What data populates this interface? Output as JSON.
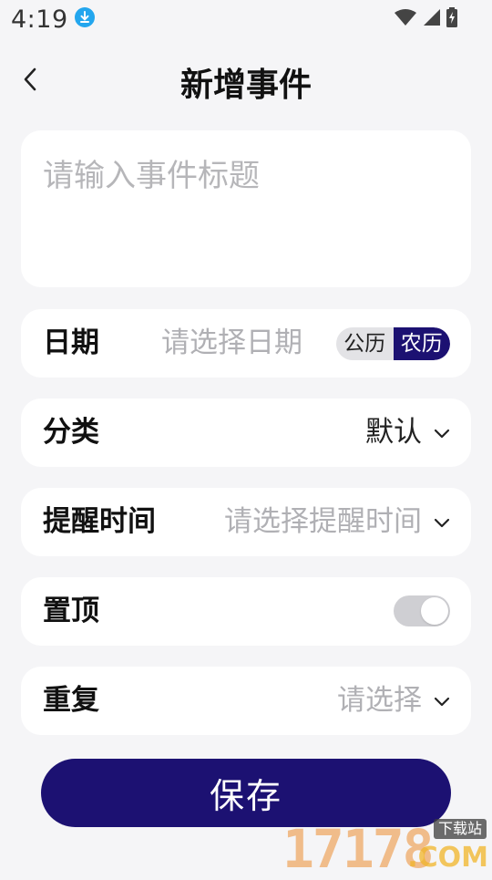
{
  "status_bar": {
    "time": "4:19",
    "icons": [
      "download-badge-icon",
      "wifi-icon",
      "signal-icon",
      "battery-charging-icon"
    ]
  },
  "header": {
    "title": "新增事件",
    "back_icon": "chevron-left-icon"
  },
  "title_input": {
    "placeholder": "请输入事件标题",
    "value": ""
  },
  "rows": {
    "date": {
      "label": "日期",
      "placeholder": "请选择日期",
      "calendar_options": [
        "公历",
        "农历"
      ],
      "selected_calendar": "农历"
    },
    "category": {
      "label": "分类",
      "value": "默认"
    },
    "reminder": {
      "label": "提醒时间",
      "placeholder": "请选择提醒时间"
    },
    "pin": {
      "label": "置顶",
      "enabled": false
    },
    "repeat": {
      "label": "重复",
      "placeholder": "请选择"
    }
  },
  "save_button": {
    "label": "保存"
  },
  "watermark": {
    "number": "17178",
    "domain": ".COM",
    "tag": "下载站"
  },
  "colors": {
    "accent": "#1c1172",
    "background": "#f5f5f7",
    "card": "#ffffff",
    "placeholder": "#b0b0b4",
    "status_download": "#23a6ee"
  }
}
